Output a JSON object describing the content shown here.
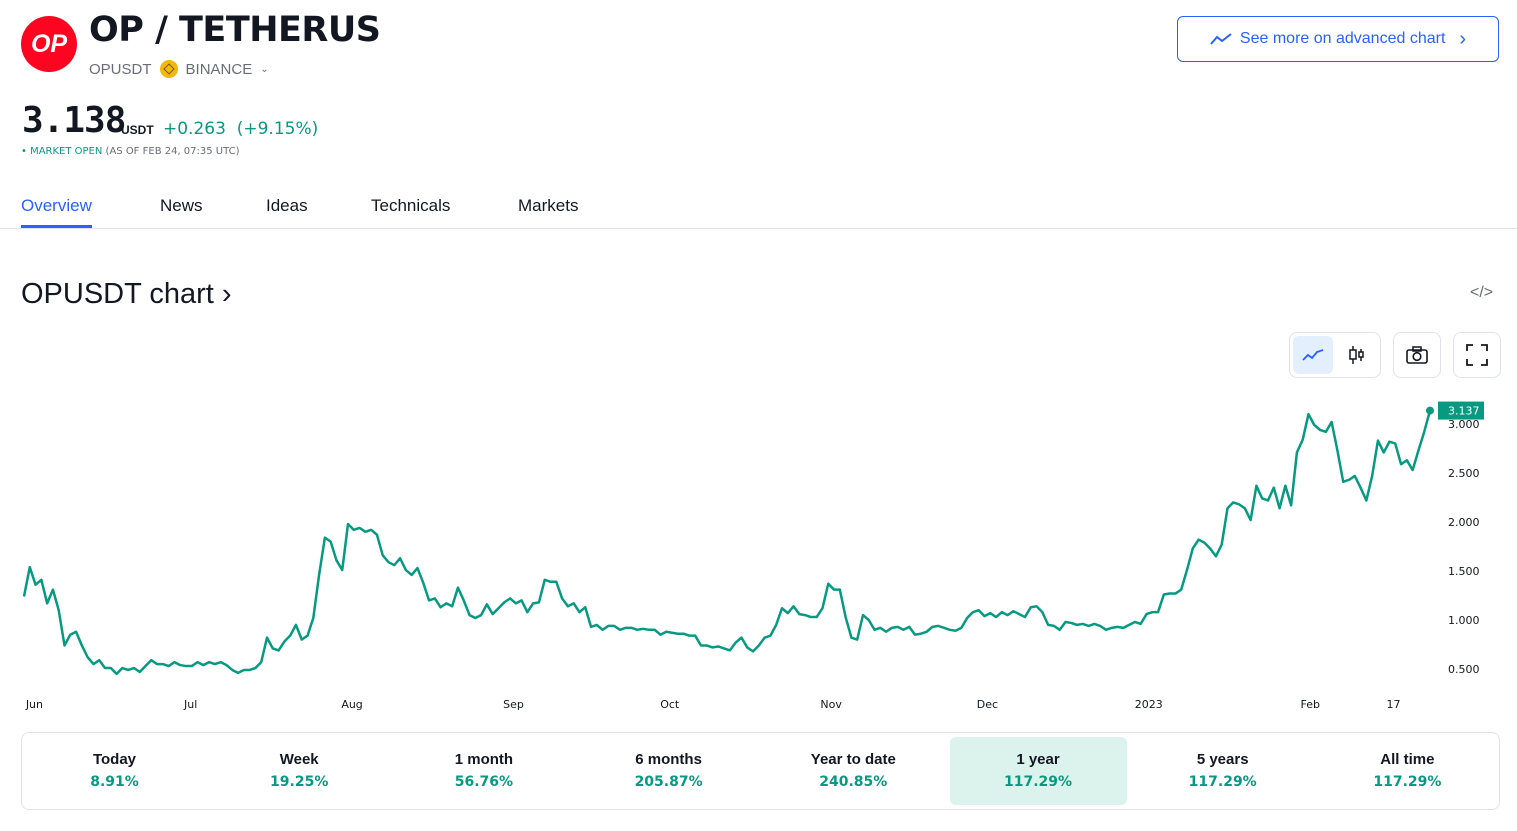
{
  "header": {
    "logo_text": "OP",
    "title": "OP / TETHERUS",
    "symbol": "OPUSDT",
    "exchange": "BINANCE",
    "price": "3.138",
    "currency": "USDT",
    "change": "+0.263",
    "change_pct": "(+9.15%)",
    "market_status": "• MARKET OPEN",
    "as_of": "(AS OF FEB 24, 07:35 UTC)",
    "advanced_chart_label": "See more on advanced chart"
  },
  "tabs": [
    {
      "label": "Overview",
      "active": true
    },
    {
      "label": "News"
    },
    {
      "label": "Ideas"
    },
    {
      "label": "Technicals"
    },
    {
      "label": "Markets"
    }
  ],
  "chart_section": {
    "title": "OPUSDT chart ›",
    "icons": [
      "embed-code-icon",
      "line-chart-icon",
      "candlestick-icon",
      "camera-icon",
      "fullscreen-icon"
    ]
  },
  "colors": {
    "accent": "#2962ff",
    "line": "#089981",
    "logo": "#ff0420"
  },
  "chart_data": {
    "type": "line",
    "x_start": "2022-05-30",
    "x_end": "2023-02-24",
    "x_ticks": [
      {
        "label": "Jun",
        "date": "2022-06-01"
      },
      {
        "label": "Jul",
        "date": "2022-07-01"
      },
      {
        "label": "Aug",
        "date": "2022-08-01"
      },
      {
        "label": "Sep",
        "date": "2022-09-01"
      },
      {
        "label": "Oct",
        "date": "2022-10-01"
      },
      {
        "label": "Nov",
        "date": "2022-11-01"
      },
      {
        "label": "Dec",
        "date": "2022-12-01"
      },
      {
        "label": "2023",
        "date": "2023-01-01"
      },
      {
        "label": "Feb",
        "date": "2023-02-01"
      },
      {
        "label": "17",
        "date": "2023-02-17"
      }
    ],
    "y_ticks": [
      "0.500",
      "1.000",
      "1.500",
      "2.000",
      "2.500",
      "3.000"
    ],
    "last_value_label": "3.137",
    "values": [
      1.24,
      1.54,
      1.36,
      1.41,
      1.17,
      1.31,
      1.1,
      0.74,
      0.85,
      0.88,
      0.74,
      0.62,
      0.55,
      0.59,
      0.51,
      0.51,
      0.45,
      0.51,
      0.49,
      0.51,
      0.47,
      0.53,
      0.59,
      0.55,
      0.55,
      0.53,
      0.57,
      0.54,
      0.53,
      0.53,
      0.57,
      0.54,
      0.57,
      0.55,
      0.57,
      0.54,
      0.49,
      0.46,
      0.49,
      0.49,
      0.51,
      0.57,
      0.82,
      0.71,
      0.69,
      0.78,
      0.84,
      0.95,
      0.8,
      0.84,
      1.02,
      1.46,
      1.84,
      1.8,
      1.61,
      1.51,
      1.98,
      1.92,
      1.94,
      1.9,
      1.92,
      1.87,
      1.66,
      1.59,
      1.56,
      1.63,
      1.51,
      1.46,
      1.53,
      1.38,
      1.2,
      1.22,
      1.13,
      1.17,
      1.14,
      1.33,
      1.2,
      1.05,
      1.02,
      1.05,
      1.16,
      1.06,
      1.12,
      1.18,
      1.22,
      1.17,
      1.2,
      1.08,
      1.17,
      1.18,
      1.41,
      1.39,
      1.39,
      1.22,
      1.14,
      1.17,
      1.08,
      1.13,
      0.93,
      0.95,
      0.9,
      0.94,
      0.94,
      0.9,
      0.92,
      0.92,
      0.9,
      0.91,
      0.9,
      0.9,
      0.85,
      0.88,
      0.87,
      0.86,
      0.86,
      0.84,
      0.84,
      0.74,
      0.74,
      0.72,
      0.73,
      0.71,
      0.69,
      0.77,
      0.82,
      0.72,
      0.68,
      0.74,
      0.82,
      0.84,
      0.95,
      1.12,
      1.07,
      1.14,
      1.06,
      1.05,
      1.03,
      1.03,
      1.12,
      1.37,
      1.31,
      1.31,
      1.03,
      0.82,
      0.8,
      1.05,
      1.0,
      0.9,
      0.92,
      0.88,
      0.92,
      0.93,
      0.9,
      0.93,
      0.85,
      0.86,
      0.88,
      0.93,
      0.94,
      0.92,
      0.9,
      0.89,
      0.92,
      1.02,
      1.08,
      1.1,
      1.04,
      1.07,
      1.03,
      1.08,
      1.05,
      1.09,
      1.06,
      1.03,
      1.13,
      1.14,
      1.08,
      0.95,
      0.94,
      0.9,
      0.98,
      0.97,
      0.95,
      0.96,
      0.94,
      0.96,
      0.94,
      0.9,
      0.92,
      0.93,
      0.92,
      0.95,
      0.98,
      0.96,
      1.06,
      1.08,
      1.08,
      1.26,
      1.27,
      1.27,
      1.31,
      1.51,
      1.73,
      1.82,
      1.79,
      1.73,
      1.65,
      1.77,
      2.14,
      2.2,
      2.18,
      2.14,
      2.02,
      2.37,
      2.24,
      2.22,
      2.35,
      2.14,
      2.37,
      2.17,
      2.71,
      2.84,
      3.1,
      2.99,
      2.94,
      2.92,
      3.02,
      2.73,
      2.41,
      2.43,
      2.47,
      2.35,
      2.22,
      2.47,
      2.83,
      2.71,
      2.82,
      2.8,
      2.59,
      2.63,
      2.53,
      2.73,
      2.92,
      3.137
    ],
    "grid": false
  },
  "periods": [
    {
      "label": "Today",
      "value": "8.91%"
    },
    {
      "label": "Week",
      "value": "19.25%"
    },
    {
      "label": "1 month",
      "value": "56.76%"
    },
    {
      "label": "6 months",
      "value": "205.87%"
    },
    {
      "label": "Year to date",
      "value": "240.85%"
    },
    {
      "label": "1 year",
      "value": "117.29%",
      "selected": true
    },
    {
      "label": "5 years",
      "value": "117.29%"
    },
    {
      "label": "All time",
      "value": "117.29%"
    }
  ]
}
